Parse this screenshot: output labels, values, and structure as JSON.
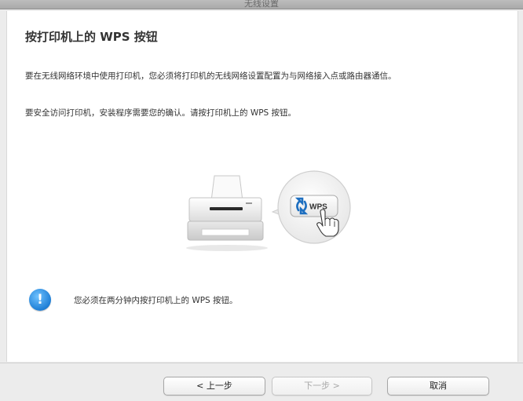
{
  "window": {
    "title": "无线设置"
  },
  "page": {
    "heading": "按打印机上的 WPS 按钮",
    "paragraph1": "要在无线网络环境中使用打印机，您必须将打印机的无线网络设置配置为与网络接入点或路由器通信。",
    "paragraph2": "要安全访问打印机，安装程序需要您的确认。请按打印机上的 WPS 按钮。",
    "wps_label": "WPS",
    "info_text": "您必须在两分钟内按打印机上的 WPS 按钮。"
  },
  "footer": {
    "back_label": "< 上一步",
    "next_label": "下一步 >",
    "cancel_label": "取消"
  },
  "colors": {
    "info_icon": "#1f7fd6",
    "wps_icon": "#1e6fc0"
  },
  "icons": {
    "printer": "printer-icon",
    "wps_button": "wps-button-icon",
    "hand": "hand-pointer-icon",
    "info": "info-icon"
  }
}
